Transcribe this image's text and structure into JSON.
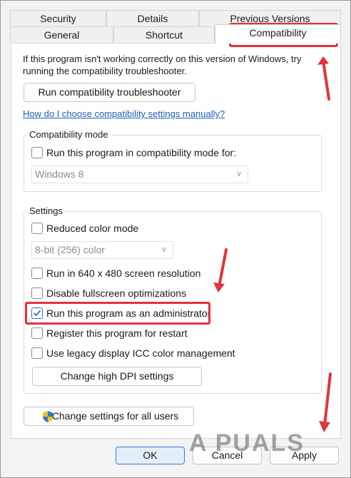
{
  "tabs": {
    "row1": [
      "Security",
      "Details",
      "Previous Versions"
    ],
    "row2": [
      "General",
      "Shortcut",
      "Compatibility"
    ],
    "active": "Compatibility"
  },
  "intro": {
    "line1": "If this program isn't working correctly on this version of Windows, try",
    "line2": "running the compatibility troubleshooter.",
    "troubleshooter_button": "Run compatibility troubleshooter",
    "help_link": "How do I choose compatibility settings manually?"
  },
  "compat_mode": {
    "label": "Compatibility mode",
    "checkbox_label": "Run this program in compatibility mode for:",
    "checked": false,
    "select_value": "Windows 8"
  },
  "settings": {
    "label": "Settings",
    "reduced_color": {
      "label": "Reduced color mode",
      "checked": false
    },
    "color_select": "8-bit (256) color",
    "res_640": {
      "label": "Run in 640 x 480 screen resolution",
      "checked": false
    },
    "fullscreen_opt": {
      "label": "Disable fullscreen optimizations",
      "checked": false
    },
    "run_as_admin": {
      "label": "Run this program as an administrator",
      "checked": true
    },
    "register_restart": {
      "label": "Register this program for restart",
      "checked": false
    },
    "legacy_icc": {
      "label": "Use legacy display ICC color management",
      "checked": false
    },
    "dpi_button": "Change high DPI settings"
  },
  "all_users_button": "Change settings for all users",
  "footer": {
    "ok": "OK",
    "cancel": "Cancel",
    "apply": "Apply"
  },
  "watermark": "A  PUALS",
  "colors": {
    "annotation": "#e0353b",
    "link": "#1b5fb8",
    "check": "#2a6fc9"
  }
}
